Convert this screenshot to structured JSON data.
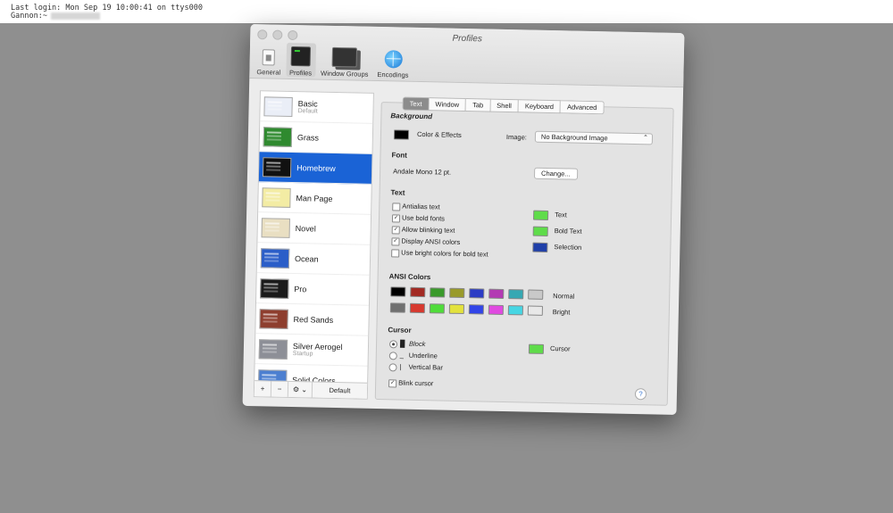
{
  "terminal": {
    "line1": "Last login: Mon Sep 19 10:00:41 on ttys000",
    "line2": "Gannon:~"
  },
  "window": {
    "title": "Profiles",
    "toolbar": [
      "General",
      "Profiles",
      "Window Groups",
      "Encodings"
    ],
    "active_toolbar": "Profiles"
  },
  "profiles": [
    {
      "name": "Basic",
      "sub": "Default",
      "bg": "#eaeef7"
    },
    {
      "name": "Grass",
      "sub": "",
      "bg": "#2f8a2f"
    },
    {
      "name": "Homebrew",
      "sub": "",
      "bg": "#111111"
    },
    {
      "name": "Man Page",
      "sub": "",
      "bg": "#f3eca4"
    },
    {
      "name": "Novel",
      "sub": "",
      "bg": "#e9dfc2"
    },
    {
      "name": "Ocean",
      "sub": "",
      "bg": "#2b5ec8"
    },
    {
      "name": "Pro",
      "sub": "",
      "bg": "#1b1b1b"
    },
    {
      "name": "Red Sands",
      "sub": "",
      "bg": "#8e3e2e"
    },
    {
      "name": "Silver Aerogel",
      "sub": "Startup",
      "bg": "#8d8f97"
    },
    {
      "name": "Solid Colors",
      "sub": "",
      "bg": "#4c7fd0"
    }
  ],
  "selected_profile": "Homebrew",
  "sidebar_buttons": {
    "add": "+",
    "remove": "−",
    "gear": "⚙ ⌄",
    "default": "Default"
  },
  "tabs": [
    "Text",
    "Window",
    "Tab",
    "Shell",
    "Keyboard",
    "Advanced"
  ],
  "active_tab": "Text",
  "background": {
    "heading": "Background",
    "color_effects": "Color & Effects",
    "image_label": "Image:",
    "image_value": "No Background Image",
    "swatch_color": "#000000"
  },
  "font": {
    "heading": "Font",
    "value": "Andale Mono 12 pt.",
    "change": "Change..."
  },
  "text": {
    "heading": "Text",
    "options": [
      {
        "label": "Antialias text",
        "checked": false
      },
      {
        "label": "Use bold fonts",
        "checked": true
      },
      {
        "label": "Allow blinking text",
        "checked": true
      },
      {
        "label": "Display ANSI colors",
        "checked": true
      },
      {
        "label": "Use bright colors for bold text",
        "checked": false
      }
    ],
    "colors": [
      {
        "label": "Text",
        "color": "#5fdc4a"
      },
      {
        "label": "Bold Text",
        "color": "#5fdc4a"
      },
      {
        "label": "Selection",
        "color": "#1f3fa8"
      }
    ]
  },
  "ansi": {
    "heading": "ANSI Colors",
    "normal_label": "Normal",
    "bright_label": "Bright",
    "normal": [
      "#000000",
      "#a22a23",
      "#3a9a2b",
      "#999a2a",
      "#2b3cc5",
      "#b33ab3",
      "#35a8b3",
      "#c9c9c9"
    ],
    "bright": [
      "#707070",
      "#d7392f",
      "#4fdc3a",
      "#e3e23d",
      "#3145e8",
      "#e04ae0",
      "#46d6e3",
      "#e8e8e8"
    ]
  },
  "cursor": {
    "heading": "Cursor",
    "options": [
      {
        "label": "Block",
        "selected": true,
        "glyph": "█"
      },
      {
        "label": "Underline",
        "selected": false,
        "glyph": "_"
      },
      {
        "label": "Vertical Bar",
        "selected": false,
        "glyph": "|"
      }
    ],
    "color_label": "Cursor",
    "color": "#5fdc4a",
    "blink_label": "Blink cursor",
    "blink_checked": true
  },
  "help": "?"
}
